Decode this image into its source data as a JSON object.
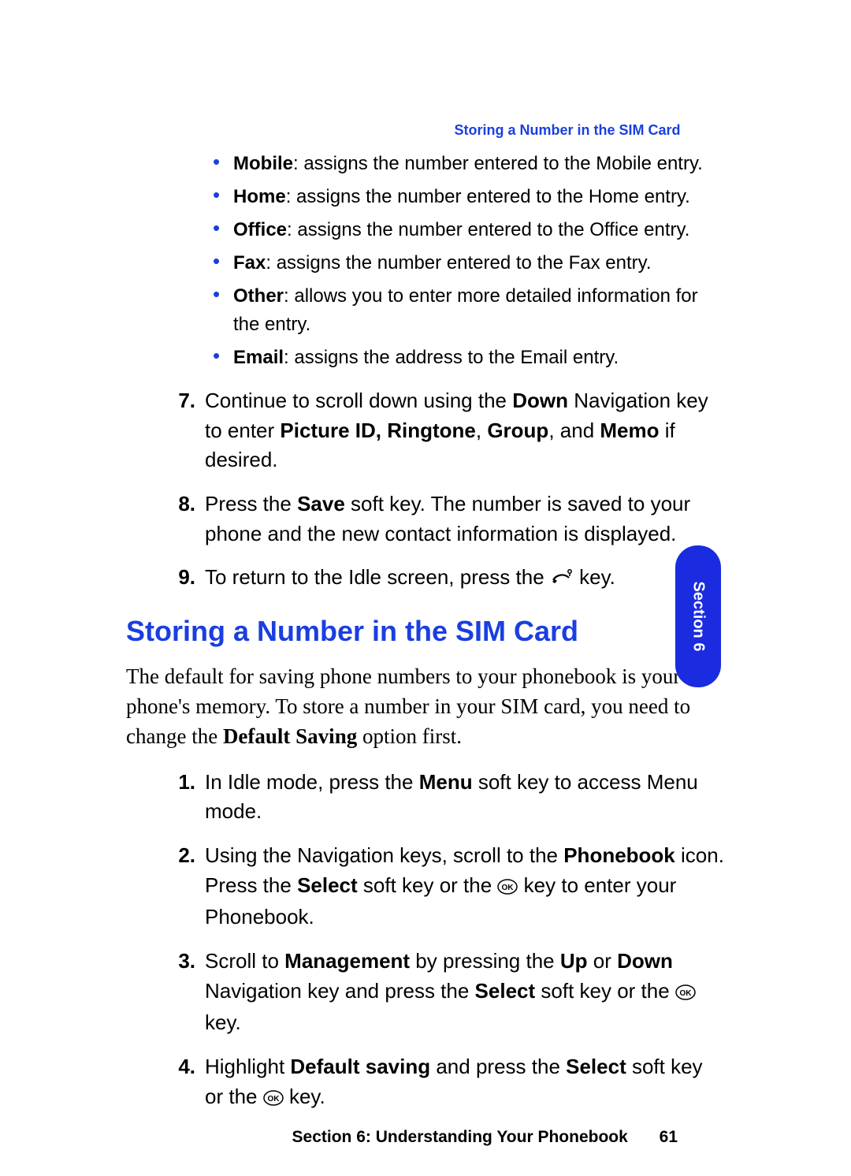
{
  "running_head": "Storing a Number in the SIM Card",
  "bullets": [
    {
      "label": "Mobile",
      "desc": ": assigns the number entered to the Mobile entry."
    },
    {
      "label": "Home",
      "desc": ": assigns the number entered to the Home entry."
    },
    {
      "label": "Office",
      "desc": ": assigns the number entered to the Office entry."
    },
    {
      "label": "Fax",
      "desc": ": assigns the number entered to the Fax entry."
    },
    {
      "label": "Other",
      "desc": ": allows you to enter more detailed information for the entry."
    },
    {
      "label": "Email",
      "desc": ": assigns the address to the Email entry."
    }
  ],
  "steps_a": {
    "s7_a": "Continue to scroll down using the ",
    "s7_b": "Down",
    "s7_c": " Navigation key to enter ",
    "s7_d": "Picture ID, Ringtone",
    "s7_e": ", ",
    "s7_f": "Group",
    "s7_g": ", and ",
    "s7_h": "Memo",
    "s7_i": " if desired.",
    "s8_a": "Press the ",
    "s8_b": "Save",
    "s8_c": " soft key. The number is saved to your phone and the new contact information is displayed.",
    "s9_a": "To return to the Idle screen, press the ",
    "s9_b": " key."
  },
  "heading": "Storing a Number in the SIM Card",
  "para_a": "The default for saving phone numbers to your phonebook is your phone's memory. To store a number in your SIM card, you need to change the ",
  "para_b": "Default Saving",
  "para_c": " option first.",
  "steps_b": {
    "s1_a": "In Idle mode, press the ",
    "s1_b": "Menu",
    "s1_c": " soft key to access Menu mode.",
    "s2_a": "Using the Navigation keys, scroll to the ",
    "s2_b": "Phonebook",
    "s2_c": " icon. Press the ",
    "s2_d": "Select",
    "s2_e": " soft key or the ",
    "s2_f": " key to enter your Phonebook.",
    "s3_a": "Scroll to ",
    "s3_b": "Management",
    "s3_c": " by pressing the ",
    "s3_d": "Up",
    "s3_e": " or ",
    "s3_f": "Down",
    "s3_g": " Navigation key and press the ",
    "s3_h": "Select",
    "s3_i": " soft key or the ",
    "s3_j": " key.",
    "s4_a": "Highlight ",
    "s4_b": "Default saving",
    "s4_c": " and press the ",
    "s4_d": "Select",
    "s4_e": " soft key or the ",
    "s4_f": " key."
  },
  "nums_a": {
    "n7": "7.",
    "n8": "8.",
    "n9": "9."
  },
  "nums_b": {
    "n1": "1.",
    "n2": "2.",
    "n3": "3.",
    "n4": "4."
  },
  "footer_label": "Section 6: Understanding Your Phonebook",
  "footer_page": "61",
  "side_tab": "Section 6"
}
